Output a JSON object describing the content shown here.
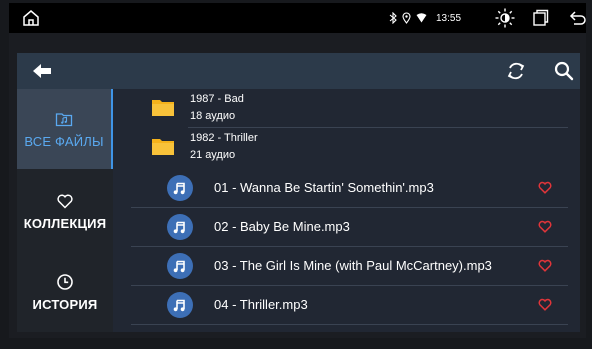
{
  "status_bar": {
    "time": "13:55",
    "icons": [
      "home-icon",
      "bluetooth-icon",
      "location-icon",
      "wifi-icon",
      "brightness-icon",
      "recent-apps-icon",
      "back-icon"
    ]
  },
  "toolbar": {
    "icons": [
      "back-arrow-icon",
      "refresh-icon",
      "search-icon"
    ]
  },
  "sidebar": {
    "items": [
      {
        "label": "ВСЕ ФАЙЛЫ",
        "icon": "music-folder-icon",
        "active": true
      },
      {
        "label": "КОЛЛЕКЦИЯ",
        "icon": "heart-outline-icon",
        "active": false
      },
      {
        "label": "ИСТОРИЯ",
        "icon": "clock-icon",
        "active": false
      }
    ]
  },
  "folders": [
    {
      "name": "1987 - Bad",
      "count": "18 аудио"
    },
    {
      "name": "1982 - Thriller",
      "count": "21 аудио"
    }
  ],
  "songs": [
    {
      "title": "01 - Wanna Be Startin' Somethin'.mp3"
    },
    {
      "title": "02 - Baby Be Mine.mp3"
    },
    {
      "title": "03 - The Girl Is Mine (with Paul McCartney).mp3"
    },
    {
      "title": "04 - Thriller.mp3"
    }
  ],
  "colors": {
    "accent": "#3f94e6",
    "heart": "#e0353a",
    "folder": "#f5b21b",
    "song_icon": "#3d6fb6"
  }
}
